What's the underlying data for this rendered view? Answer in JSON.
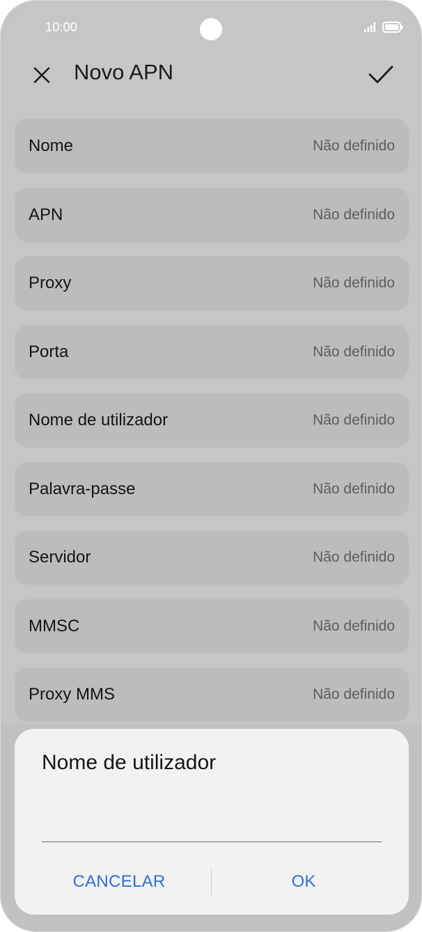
{
  "status_bar": {
    "time": "10:00",
    "icons": [
      "signal-icon",
      "battery-icon"
    ]
  },
  "header": {
    "title": "Novo APN",
    "close_icon": "close-icon",
    "confirm_icon": "check-icon"
  },
  "fields": [
    {
      "label": "Nome",
      "value": "Não definido"
    },
    {
      "label": "APN",
      "value": "Não definido"
    },
    {
      "label": "Proxy",
      "value": "Não definido"
    },
    {
      "label": "Porta",
      "value": "Não definido"
    },
    {
      "label": "Nome de utilizador",
      "value": "Não definido"
    },
    {
      "label": "Palavra-passe",
      "value": "Não definido"
    },
    {
      "label": "Servidor",
      "value": "Não definido"
    },
    {
      "label": "MMSC",
      "value": "Não definido"
    },
    {
      "label": "Proxy MMS",
      "value": "Não definido"
    }
  ],
  "dialog": {
    "title": "Nome de utilizador",
    "input_value": "",
    "cancel_label": "CANCELAR",
    "ok_label": "OK"
  },
  "colors": {
    "accent": "#2f6fd2",
    "scrim": "#c6c6c8",
    "dialog_bg": "#f2f2f2"
  }
}
